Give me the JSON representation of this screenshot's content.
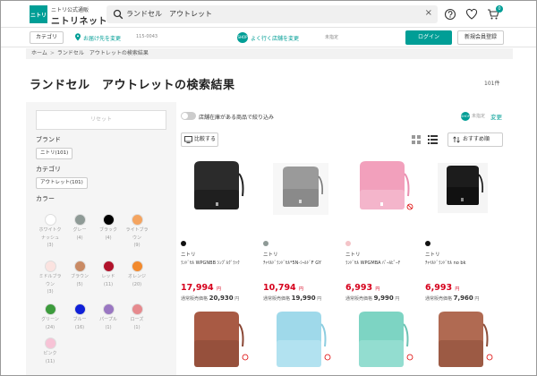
{
  "header": {
    "logo_text": "ニトリ",
    "brand_sub": "ニトリ公式通販",
    "brand_main": "ニトリネット",
    "search_value": "ランドセル　アウトレット",
    "clear": "×",
    "cart_count": "0"
  },
  "subheader": {
    "category": "カテゴリ",
    "deliver_to": "お届け先を変更",
    "zip": "115-0043",
    "shop_icon": "SHOP",
    "shop_change": "よく行く店舗を変更",
    "shop_none": "未指定",
    "login": "ログイン",
    "register": "新規会員登録"
  },
  "breadcrumb": {
    "home": "ホーム",
    "sep": ">",
    "current": "ランドセル　アウトレットの検索結果"
  },
  "page": {
    "title": "ランドセル　アウトレットの検索結果",
    "count": "101件"
  },
  "sidebar": {
    "reset": "リセット",
    "brand_heading": "ブランド",
    "brand_chip": "ニトリ(101)",
    "category_heading": "カテゴリ",
    "category_chip": "アウトレット(101)",
    "color_heading": "カラー",
    "colors": [
      {
        "l1": "ホワイトク",
        "l2": "ナッシュ",
        "l3": "(3)",
        "color": "#ffffff"
      },
      {
        "l1": "グレー",
        "l2": "(4)",
        "l3": "",
        "color": "#8e9a96"
      },
      {
        "l1": "ブラック",
        "l2": "(4)",
        "l3": "",
        "color": "#000000"
      },
      {
        "l1": "ライトブラ",
        "l2": "ウン",
        "l3": "(9)",
        "color": "#f4a460"
      },
      {
        "l1": "ミドルブラ",
        "l2": "ウン",
        "l3": "(3)",
        "color": "#fbe3e0"
      },
      {
        "l1": "ブラウン",
        "l2": "(5)",
        "l3": "",
        "color": "#c98a64"
      },
      {
        "l1": "レッド",
        "l2": "(11)",
        "l3": "",
        "color": "#b1132b"
      },
      {
        "l1": "オレンジ",
        "l2": "(20)",
        "l3": "",
        "color": "#f28a2e"
      },
      {
        "l1": "グリーン",
        "l2": "(24)",
        "l3": "",
        "color": "#3c9b3c"
      },
      {
        "l1": "ブルー",
        "l2": "(16)",
        "l3": "",
        "color": "#1020d8"
      },
      {
        "l1": "パープル",
        "l2": "(1)",
        "l3": "",
        "color": "#9a77c2"
      },
      {
        "l1": "ローズ",
        "l2": "(1)",
        "l3": "",
        "color": "#e68a8e"
      },
      {
        "l1": "ピンク",
        "l2": "(11)",
        "l3": "",
        "color": "#f7c3d6"
      }
    ]
  },
  "main": {
    "toggle_label": "店舗在庫がある商品で絞り込み",
    "shop_icon": "SHOP",
    "shop_none": "未指定",
    "change": "変更",
    "compare": "比較する",
    "sort": "おすすめ順",
    "regular_label": "通常販売価格",
    "yen": "円",
    "products": [
      {
        "brand": "ニトリ",
        "name": "ﾗﾝﾄﾞｾﾙ WPGNBB ｼﾝﾌﾟﾙｸﾞﾗｯｸ",
        "price": "17,994",
        "regular": "20,930",
        "dot": "#111111",
        "body": "#2b2b2b"
      },
      {
        "brand": "ニトリ",
        "name": "ﾁｬｲﾙﾄﾞﾗﾝﾄﾞｾﾙ*5N-ｼｰﾙﾄﾞF GY",
        "price": "10,794",
        "regular": "19,990",
        "dot": "#8e9a96",
        "body": "#9a9a9a"
      },
      {
        "brand": "ニトリ",
        "name": "ﾗﾝﾄﾞｾﾙ WPGMBA ﾊﾟｰﾙﾋﾟｰﾁ",
        "price": "6,993",
        "regular": "9,990",
        "dot": "#f4c4c8",
        "body": "#f2a0bc"
      },
      {
        "brand": "ニトリ",
        "name": "ﾁｬｲﾙﾄﾞﾗﾝﾄﾞｾﾙ no bk",
        "price": "6,993",
        "regular": "7,960",
        "dot": "#111111",
        "body": "#1c1c1c"
      }
    ],
    "row2_colors": [
      "#a85a44",
      "#9fd9ea",
      "#7dd4c3",
      "#b06a52"
    ]
  }
}
